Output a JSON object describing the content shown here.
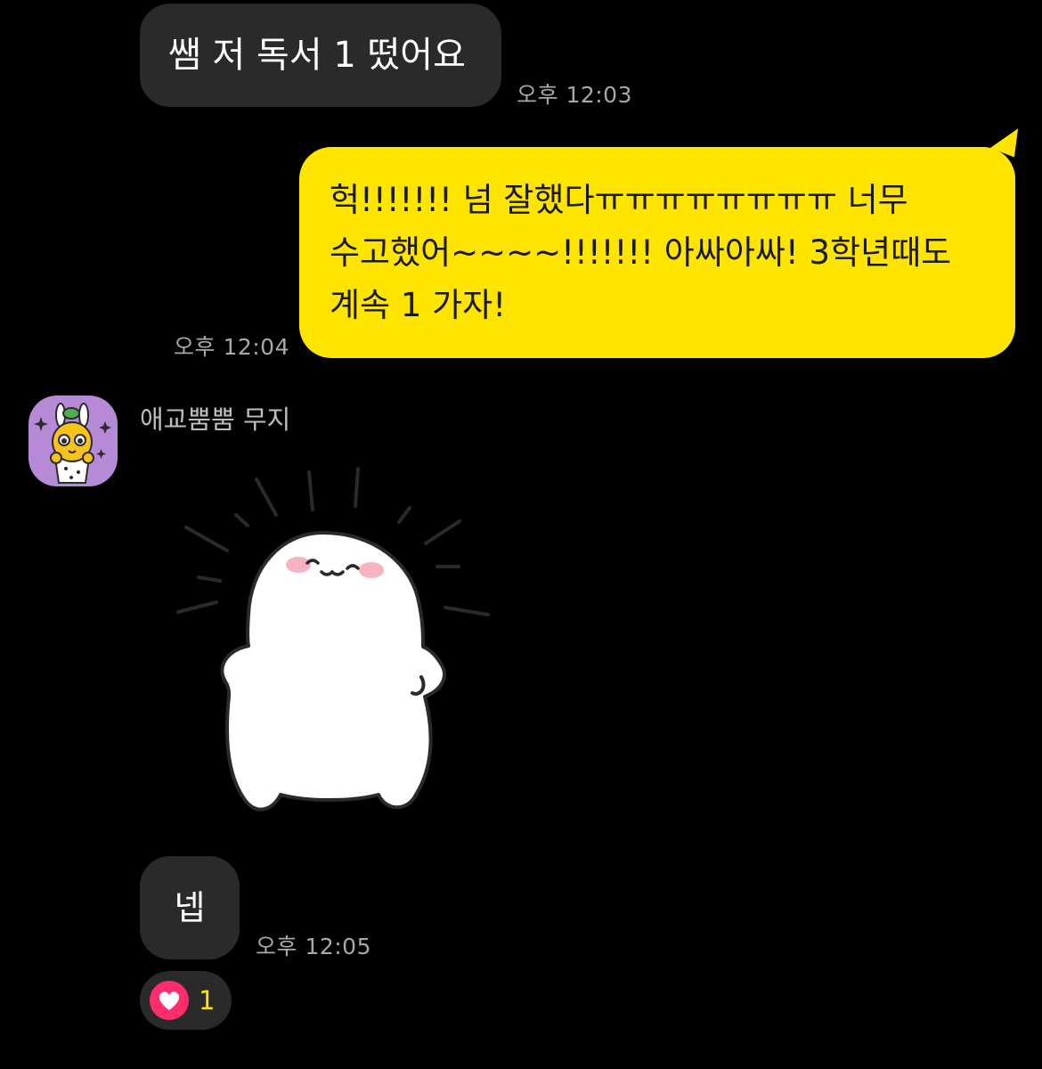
{
  "messages": {
    "msg1": {
      "text": "쌤 저 독서 1 떴어요",
      "time": "오후 12:03"
    },
    "msg2": {
      "line1": "헉!!!!!!! 넘 잘했다ㅠㅠㅠㅠㅠㅠㅠㅠ 너무",
      "line2": "수고했어~~~~!!!!!!! 아싸아싸! 3학년때도",
      "line3": "계속 1 가자!",
      "time": "오후 12:04"
    },
    "sender": {
      "name": "애교뿜뿜 무지"
    },
    "msg3": {
      "text": "넵",
      "time": "오후 12:05"
    }
  },
  "reaction": {
    "icon": "heart-icon",
    "count": "1"
  },
  "colors": {
    "background": "#000000",
    "incoming_bubble": "#2a2a2a",
    "outgoing_bubble": "#fee500",
    "timestamp": "#a8a8a8",
    "avatar_bg": "#b68ad6",
    "heart": "#ff2d6b"
  }
}
